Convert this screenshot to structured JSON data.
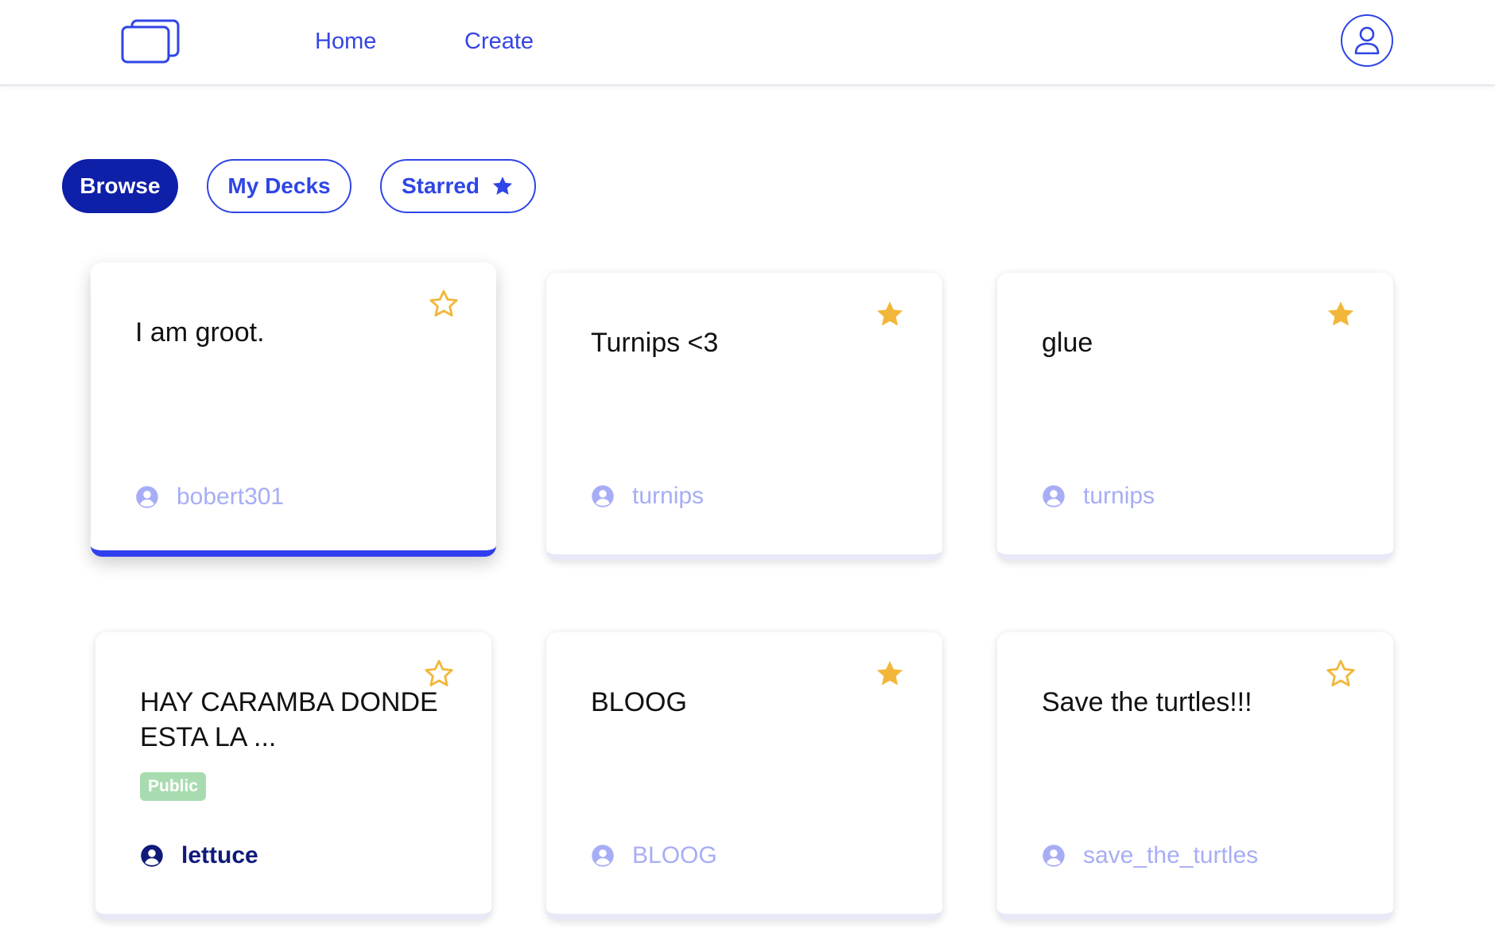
{
  "nav": {
    "home_label": "Home",
    "create_label": "Create",
    "logo_icon": "cards-stack-icon",
    "profile_icon": "user-icon",
    "accent_color": "#3545e3"
  },
  "filters": {
    "browse_label": "Browse",
    "mydecks_label": "My Decks",
    "starred_label": "Starred",
    "active": "Browse"
  },
  "decks": [
    {
      "title": "I am groot.",
      "author": "bobert301",
      "starred": false,
      "active": true
    },
    {
      "title": "Turnips <3",
      "author": "turnips",
      "starred": true
    },
    {
      "title": "glue",
      "author": "turnips",
      "starred": true
    },
    {
      "title": "HAY CARAMBA DONDE ESTA LA ...",
      "author": "lettuce",
      "starred": false,
      "badge": "Public",
      "owner": true
    },
    {
      "title": "BLOOG",
      "author": "BLOOG",
      "starred": true
    },
    {
      "title": "Save the turtles!!!",
      "author": "save_the_turtles",
      "starred": false
    }
  ],
  "colors": {
    "star_gold": "#f2b73a",
    "primary_dark": "#0e1fa8",
    "author_muted": "#a7adf5",
    "badge_green": "#a8dcb0"
  }
}
